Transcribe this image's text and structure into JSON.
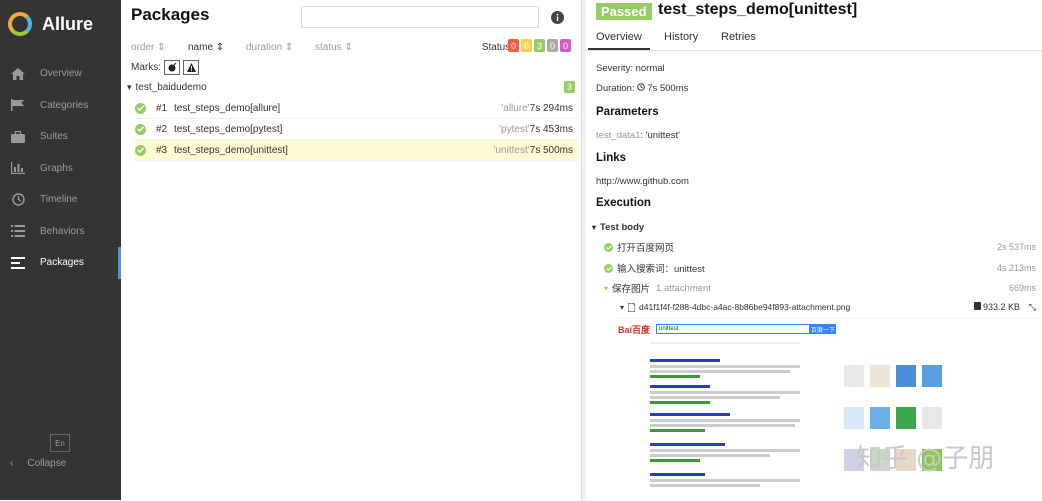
{
  "app": {
    "name": "Allure"
  },
  "sidebar": {
    "items": [
      {
        "label": "Overview",
        "icon": "home-icon"
      },
      {
        "label": "Categories",
        "icon": "flag-icon"
      },
      {
        "label": "Suites",
        "icon": "briefcase-icon"
      },
      {
        "label": "Graphs",
        "icon": "bar-chart-icon"
      },
      {
        "label": "Timeline",
        "icon": "clock-icon"
      },
      {
        "label": "Behaviors",
        "icon": "list-icon"
      },
      {
        "label": "Packages",
        "icon": "align-left-icon",
        "active": true
      }
    ],
    "language": "En",
    "collapse_label": "Collapse"
  },
  "packages": {
    "title": "Packages",
    "sort": {
      "order": "order",
      "name": "name",
      "duration": "duration",
      "status": "status"
    },
    "status_label": "Status:",
    "status_counts": [
      {
        "value": "0",
        "color": "#fd5a3e"
      },
      {
        "value": "0",
        "color": "#ffd050"
      },
      {
        "value": "3",
        "color": "#97cc64"
      },
      {
        "value": "0",
        "color": "#aaaaaa"
      },
      {
        "value": "0",
        "color": "#d35ebe"
      }
    ],
    "marks_label": "Marks:",
    "group": {
      "name": "test_baidudemo",
      "count": "3"
    },
    "rows": [
      {
        "num": "#1",
        "name": "test_steps_demo[allure]",
        "pkg": "'allure'",
        "duration": "7s 294ms"
      },
      {
        "num": "#2",
        "name": "test_steps_demo[pytest]",
        "pkg": "'pytest'",
        "duration": "7s 453ms"
      },
      {
        "num": "#3",
        "name": "test_steps_demo[unittest]",
        "pkg": "'unittest'",
        "duration": "7s 500ms",
        "selected": true
      }
    ]
  },
  "detail": {
    "status": "Passed",
    "title": "test_steps_demo[unittest]",
    "tabs": [
      "Overview",
      "History",
      "Retries"
    ],
    "severity": "Severity: normal",
    "duration": "Duration: ",
    "duration_value": "7s 500ms",
    "parameters_heading": "Parameters",
    "param_name": "test_data1",
    "param_value": ": 'unittest'",
    "links_heading": "Links",
    "link": "http://www.github.com",
    "execution_heading": "Execution",
    "test_body_label": "Test body",
    "steps": [
      {
        "name": "打开百度网页",
        "time": "2s 537ms"
      },
      {
        "name": "输入搜索词：unittest",
        "time": "4s 213ms"
      },
      {
        "name": "保存图片",
        "extra": "1 attachment",
        "time": "669ms"
      }
    ],
    "attachment": {
      "name": "d41f1f4f-f288-4dbc-a4ac-8b86be94f893-attachment.png",
      "size": "933.2 KB"
    },
    "screenshot": {
      "logo": "Bai百度",
      "query": "unittest",
      "button": "百度一下"
    }
  },
  "watermark": "知乎 @子朋"
}
